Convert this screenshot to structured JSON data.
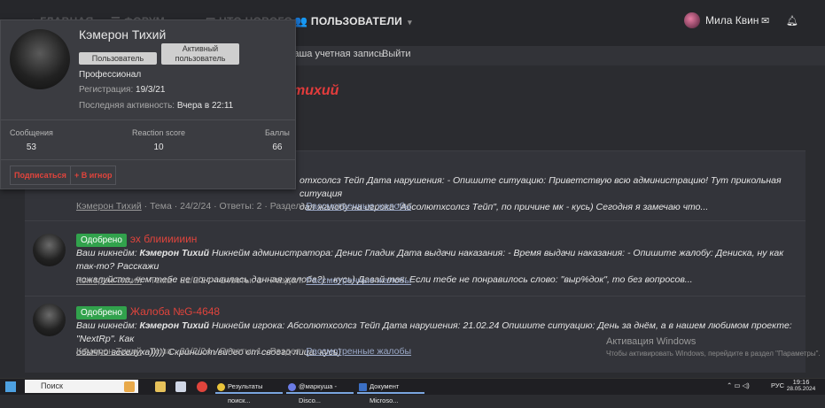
{
  "topnav": {
    "items": [
      {
        "label": "ГЛАВНАЯ",
        "icon": "home-icon"
      },
      {
        "label": "ФОРУМ",
        "icon": "forum-icon"
      },
      {
        "label": "ЧТО НОВОГО",
        "icon": "news-icon"
      },
      {
        "label": "ПОЛЬЗОВАТЕЛИ",
        "icon": "users-icon"
      }
    ],
    "user_name": "Мила Квин",
    "icons": [
      "envelope-icon",
      "bell-icon"
    ]
  },
  "subnav": {
    "items": [
      "Ваша учетная запись",
      "Выйти"
    ]
  },
  "page_title": "тихий",
  "popup": {
    "name": "Кэмерон Тихий",
    "badges": [
      "Пользователь",
      "Активный пользователь"
    ],
    "role": "Профессионал",
    "registration_label": "Регистрация:",
    "registration_value": "19/3/21",
    "last_activity_label": "Последняя активность:",
    "last_activity_value": "Вчера в 22:11",
    "stats": [
      {
        "label": "Сообщения",
        "value": "53"
      },
      {
        "label": "Reaction score",
        "value": "10"
      },
      {
        "label": "Баллы",
        "value": "66"
      }
    ],
    "actions": [
      "Подписаться",
      "+ В игнор"
    ]
  },
  "results": [
    {
      "badge": "",
      "title": "",
      "snippet_1": "отхсолсз Тейп Дата нарушения: - Опишите ситуацию: Приветствую всю администрацию! Тут прикольная ситуация",
      "snippet_2": "дал жалобу на игрока \"Абсолютхсолсз Тейп\", по причине мк - кусь) Сегодня я замечаю что...",
      "author": "Кэмерон Тихий",
      "meta": "· Тема · 24/2/24 · Ответы: 2 · Раздел:",
      "section": "Рассмотренные жалобы"
    },
    {
      "badge": "Одобрено",
      "title": "эх блиииииин",
      "snippet_lead": "Ваш никнейм:",
      "snippet_name": "Кэмерон Тихий",
      "snippet_1": "Никнейм администратора: Денис Гладик Дата выдачи наказания: - Время выдачи наказания: - Опишите жалобу: Дениска, ну как так-то? Расскажи",
      "snippet_2": "пожалуйста, чем тебе не понравилась данная жалоба?) - кусь) Давай так: Если тебе не понравилось слово: \"выр%док\", то без вопросов...",
      "author": "Кэмерон Тихий",
      "meta": "· Тема · 21/2/24 · Ответы: 1 · Раздел:",
      "section": "Рассмотренные жалобы"
    },
    {
      "badge": "Одобрено",
      "title": "Жалоба №G-4648",
      "snippet_lead": "Ваш никнейм:",
      "snippet_name": "Кэмерон Тихий",
      "snippet_1": "Никнейм игрока: Абсолютхсолсз Тейп Дата нарушения: 21.02.24 Опишите ситуацию: День за днём, а в нашем любимом проекте: \"NextRp\". Как",
      "snippet_2": "обычно веселуха))))) Скриншот/видео от своего лица: кусь)",
      "author": "Кэмерон Тихий",
      "meta": "· Тема · 21/2/24 · Ответы: 1 · Раздел:",
      "section": "Рассмотренные жалобы"
    }
  ],
  "windows_activation": {
    "line1": "Активация Windows",
    "line2": "Чтобы активировать Windows, перейдите в раздел \"Параметры\"."
  },
  "taskbar": {
    "search_placeholder": "Поиск",
    "tasks": [
      "Результаты поиск...",
      "@маркуша - Disco...",
      "Документ Microso..."
    ],
    "lang": "РУС",
    "time": "19:16",
    "date": "28.05.2024"
  },
  "colors": {
    "accent_red": "#e0443c",
    "approved_green": "#31a24c",
    "link_blue": "#9aa8c7"
  }
}
